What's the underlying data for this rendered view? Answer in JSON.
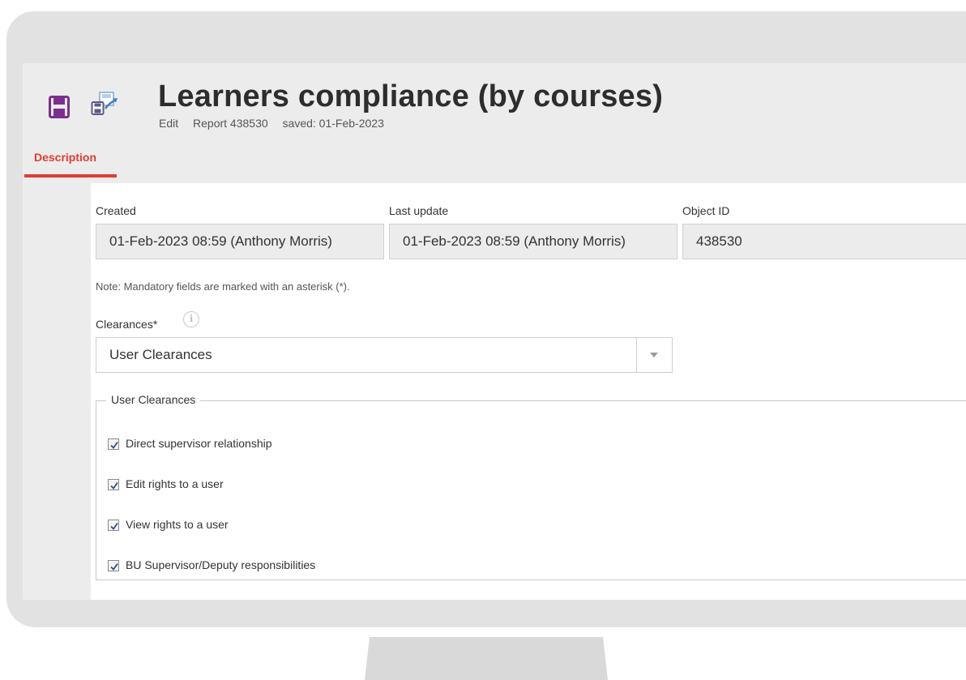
{
  "header": {
    "title": "Learners compliance (by courses)",
    "mode": "Edit",
    "report": "Report 438530",
    "saved": "saved: 01-Feb-2023"
  },
  "tabs": [
    {
      "label": "Description"
    }
  ],
  "fields": {
    "created": {
      "label": "Created",
      "value": "01-Feb-2023 08:59 (Anthony Morris)"
    },
    "last_update": {
      "label": "Last update",
      "value": "01-Feb-2023 08:59 (Anthony Morris)"
    },
    "object_id": {
      "label": "Object ID",
      "value": "438530"
    }
  },
  "note": "Note: Mandatory fields are marked with an asterisk (*).",
  "clearances": {
    "label": "Clearances*",
    "selected": "User Clearances"
  },
  "user_clearances": {
    "legend": "User Clearances",
    "items": [
      {
        "label": "Direct supervisor relationship",
        "checked": true
      },
      {
        "label": "Edit rights to a user",
        "checked": true
      },
      {
        "label": "View rights to a user",
        "checked": true
      },
      {
        "label": "BU Supervisor/Deputy responsibilities",
        "checked": true
      }
    ]
  },
  "colors": {
    "accent": "#e03c31",
    "save_icon": "#7b2f8e",
    "saveas_icon": "#3a7fc4"
  }
}
